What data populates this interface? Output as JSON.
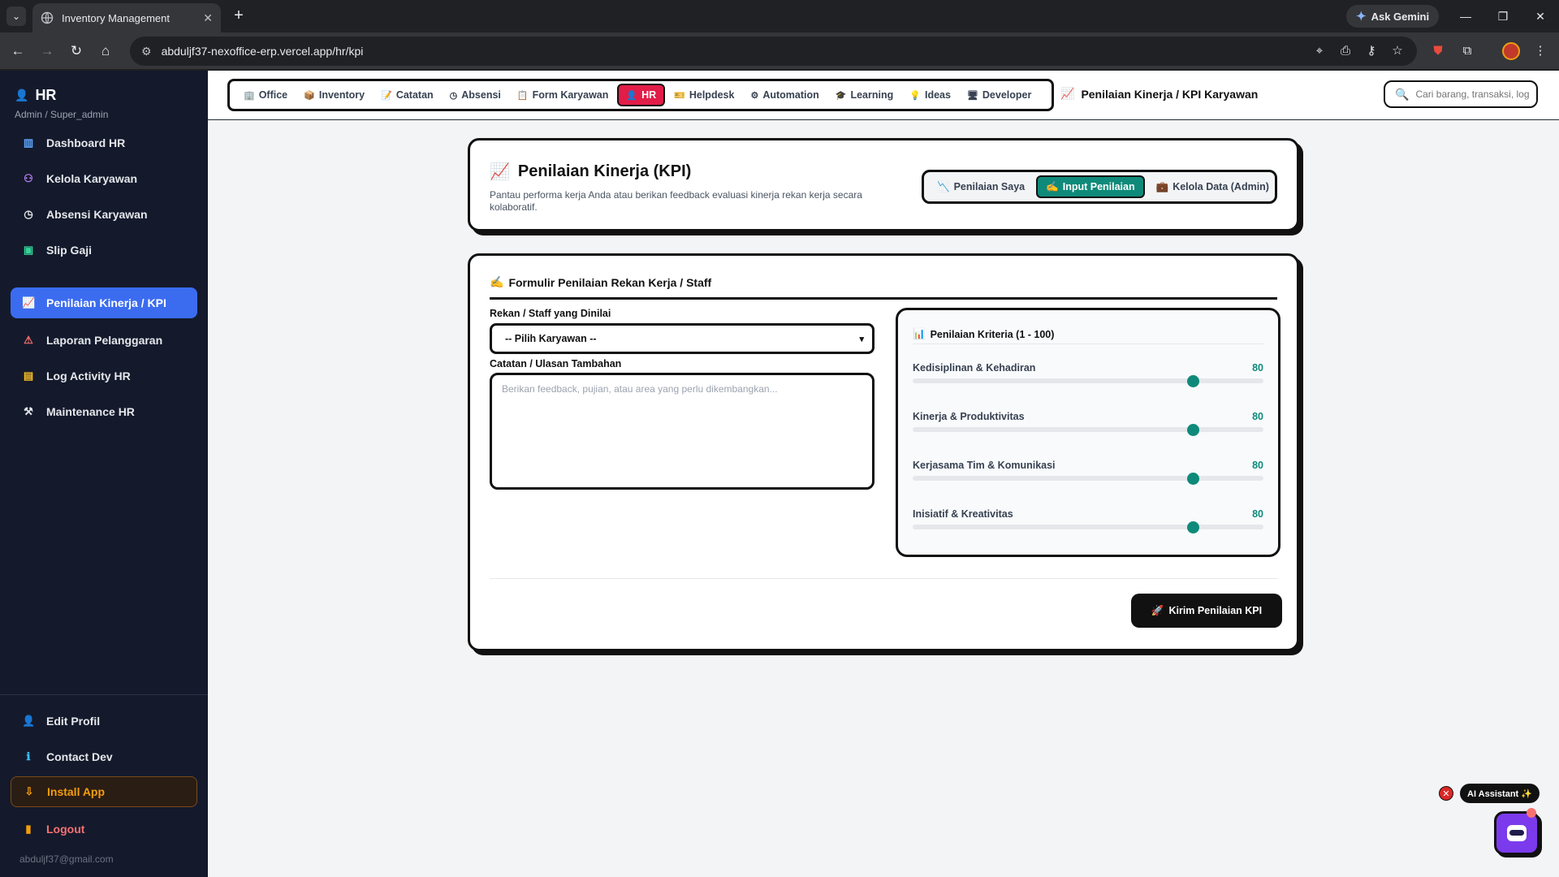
{
  "browser": {
    "tab_title": "Inventory Management",
    "url": "abduljf37-nexoffice-erp.vercel.app/hr/kpi",
    "gemini_label": "Ask Gemini"
  },
  "sidebar": {
    "title": "HR",
    "subtitle": "Admin / Super_admin",
    "items": [
      {
        "label": "Dashboard HR",
        "icon": "chart-icon"
      },
      {
        "label": "Kelola Karyawan",
        "icon": "people-icon"
      },
      {
        "label": "Absensi Karyawan",
        "icon": "clock-icon"
      },
      {
        "label": "Slip Gaji",
        "icon": "money-icon"
      },
      {
        "label": "Penilaian Kinerja / KPI",
        "icon": "trend-icon"
      },
      {
        "label": "Laporan Pelanggaran",
        "icon": "alarm-icon"
      },
      {
        "label": "Log Activity HR",
        "icon": "clipboard-icon"
      },
      {
        "label": "Maintenance HR",
        "icon": "tools-icon"
      }
    ],
    "bottom": {
      "edit_profile": "Edit Profil",
      "contact_dev": "Contact Dev",
      "install_app": "Install App",
      "logout": "Logout",
      "email": "abduljf37@gmail.com"
    }
  },
  "topnav": {
    "modules": [
      "Office",
      "Inventory",
      "Catatan",
      "Absensi",
      "Form Karyawan",
      "HR",
      "Helpdesk",
      "Automation",
      "Learning",
      "Ideas",
      "Developer"
    ],
    "active_module": "HR",
    "breadcrumb": "Penilaian Kinerja / KPI Karyawan",
    "search_placeholder": "Cari barang, transaksi, log..."
  },
  "header": {
    "title": "Penilaian Kinerja (KPI)",
    "subtitle": "Pantau performa kerja Anda atau berikan feedback evaluasi kinerja rekan kerja secara kolaboratif.",
    "tabs": [
      "Penilaian Saya",
      "Input Penilaian",
      "Kelola Data (Admin)"
    ],
    "active_tab": "Input Penilaian"
  },
  "form": {
    "title": "Formulir Penilaian Rekan Kerja / Staff",
    "staff_label": "Rekan / Staff yang Dinilai",
    "staff_value": "-- Pilih Karyawan --",
    "notes_label": "Catatan / Ulasan Tambahan",
    "notes_placeholder": "Berikan feedback, pujian, atau area yang perlu dikembangkan...",
    "criteria_title": "Penilaian Kriteria (1 - 100)",
    "criteria": [
      {
        "name": "Kedisiplinan & Kehadiran",
        "value": "80"
      },
      {
        "name": "Kinerja & Produktivitas",
        "value": "80"
      },
      {
        "name": "Kerjasama Tim & Komunikasi",
        "value": "80"
      },
      {
        "name": "Inisiatif & Kreativitas",
        "value": "80"
      }
    ],
    "submit_label": "Kirim Penilaian KPI"
  },
  "assistant": {
    "label": "AI Assistant ✨"
  },
  "colors": {
    "accent_teal": "#0f8a7a",
    "active_module": "#e11d48",
    "sidebar_active": "#3b6cf0",
    "sidebar_bg": "#141a2c"
  }
}
